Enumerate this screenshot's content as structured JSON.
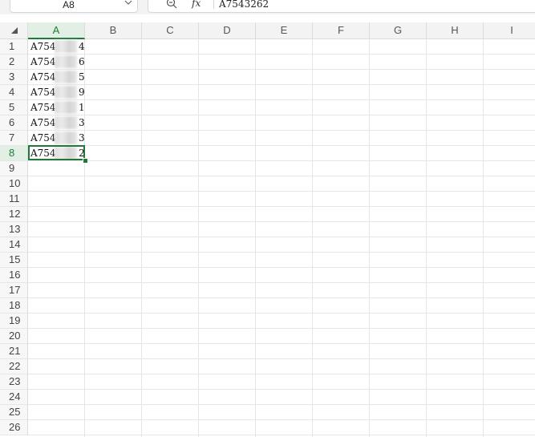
{
  "formula_bar": {
    "name_box": "A8",
    "fx_label": "fx",
    "value": "A7543262"
  },
  "columns": [
    "A",
    "B",
    "C",
    "D",
    "E",
    "F",
    "G",
    "H",
    "I"
  ],
  "selected_column": "A",
  "rows": [
    "1",
    "2",
    "3",
    "4",
    "5",
    "6",
    "7",
    "8",
    "9",
    "10",
    "11",
    "12",
    "13",
    "14",
    "15",
    "16",
    "17",
    "18",
    "19",
    "20",
    "21",
    "22",
    "23",
    "24",
    "25",
    "26"
  ],
  "selected_row": "8",
  "cells_A": [
    "A754 4",
    "A754 6",
    "A754 5",
    "A754 9",
    "A754 1",
    "A754 3",
    "A754 3",
    "A754 2"
  ],
  "cells_A_visible": [
    {
      "prefix": "A754",
      "suffix": "4"
    },
    {
      "prefix": "A754",
      "suffix": "6"
    },
    {
      "prefix": "A754",
      "suffix": "5"
    },
    {
      "prefix": "A754",
      "suffix": "9"
    },
    {
      "prefix": "A754",
      "suffix": "1"
    },
    {
      "prefix": "A754",
      "suffix": "3"
    },
    {
      "prefix": "A754",
      "suffix": "3"
    },
    {
      "prefix": "A754",
      "suffix": "2"
    }
  ],
  "colors": {
    "accent": "#1f7a3a",
    "grid": "#e6e6e6",
    "header_bg": "#f3f3f3"
  },
  "icons": {
    "zoom": "zoom-out-icon",
    "chevron": "chevron-down-icon",
    "corner": "select-all-triangle-icon"
  }
}
